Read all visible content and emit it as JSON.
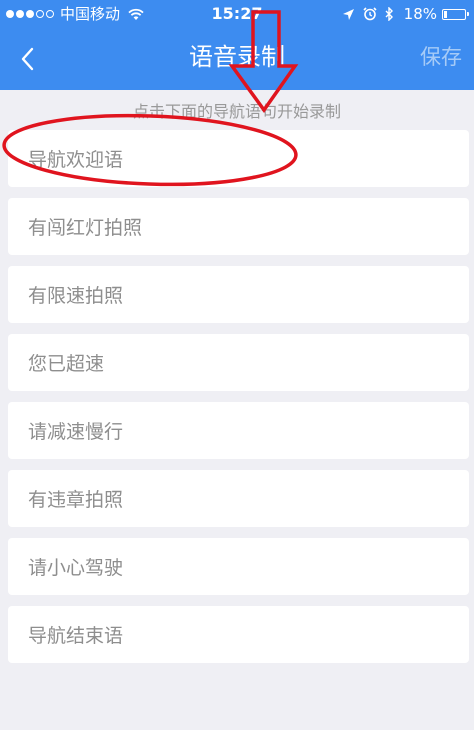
{
  "status_bar": {
    "carrier": "中国移动",
    "time": "15:27",
    "battery_percent_text": "18%",
    "battery_level": 0.18
  },
  "nav": {
    "title": "语音录制",
    "save_label": "保存"
  },
  "hint": "点击下面的导航语句开始录制",
  "items": [
    {
      "label": "导航欢迎语"
    },
    {
      "label": "有闯红灯拍照"
    },
    {
      "label": "有限速拍照"
    },
    {
      "label": "您已超速"
    },
    {
      "label": "请减速慢行"
    },
    {
      "label": "有违章拍照"
    },
    {
      "label": "请小心驾驶"
    },
    {
      "label": "导航结束语"
    }
  ],
  "colors": {
    "header_bg": "#3d8cf0",
    "page_bg": "#efeff4",
    "annotation_red": "#e0141e"
  }
}
